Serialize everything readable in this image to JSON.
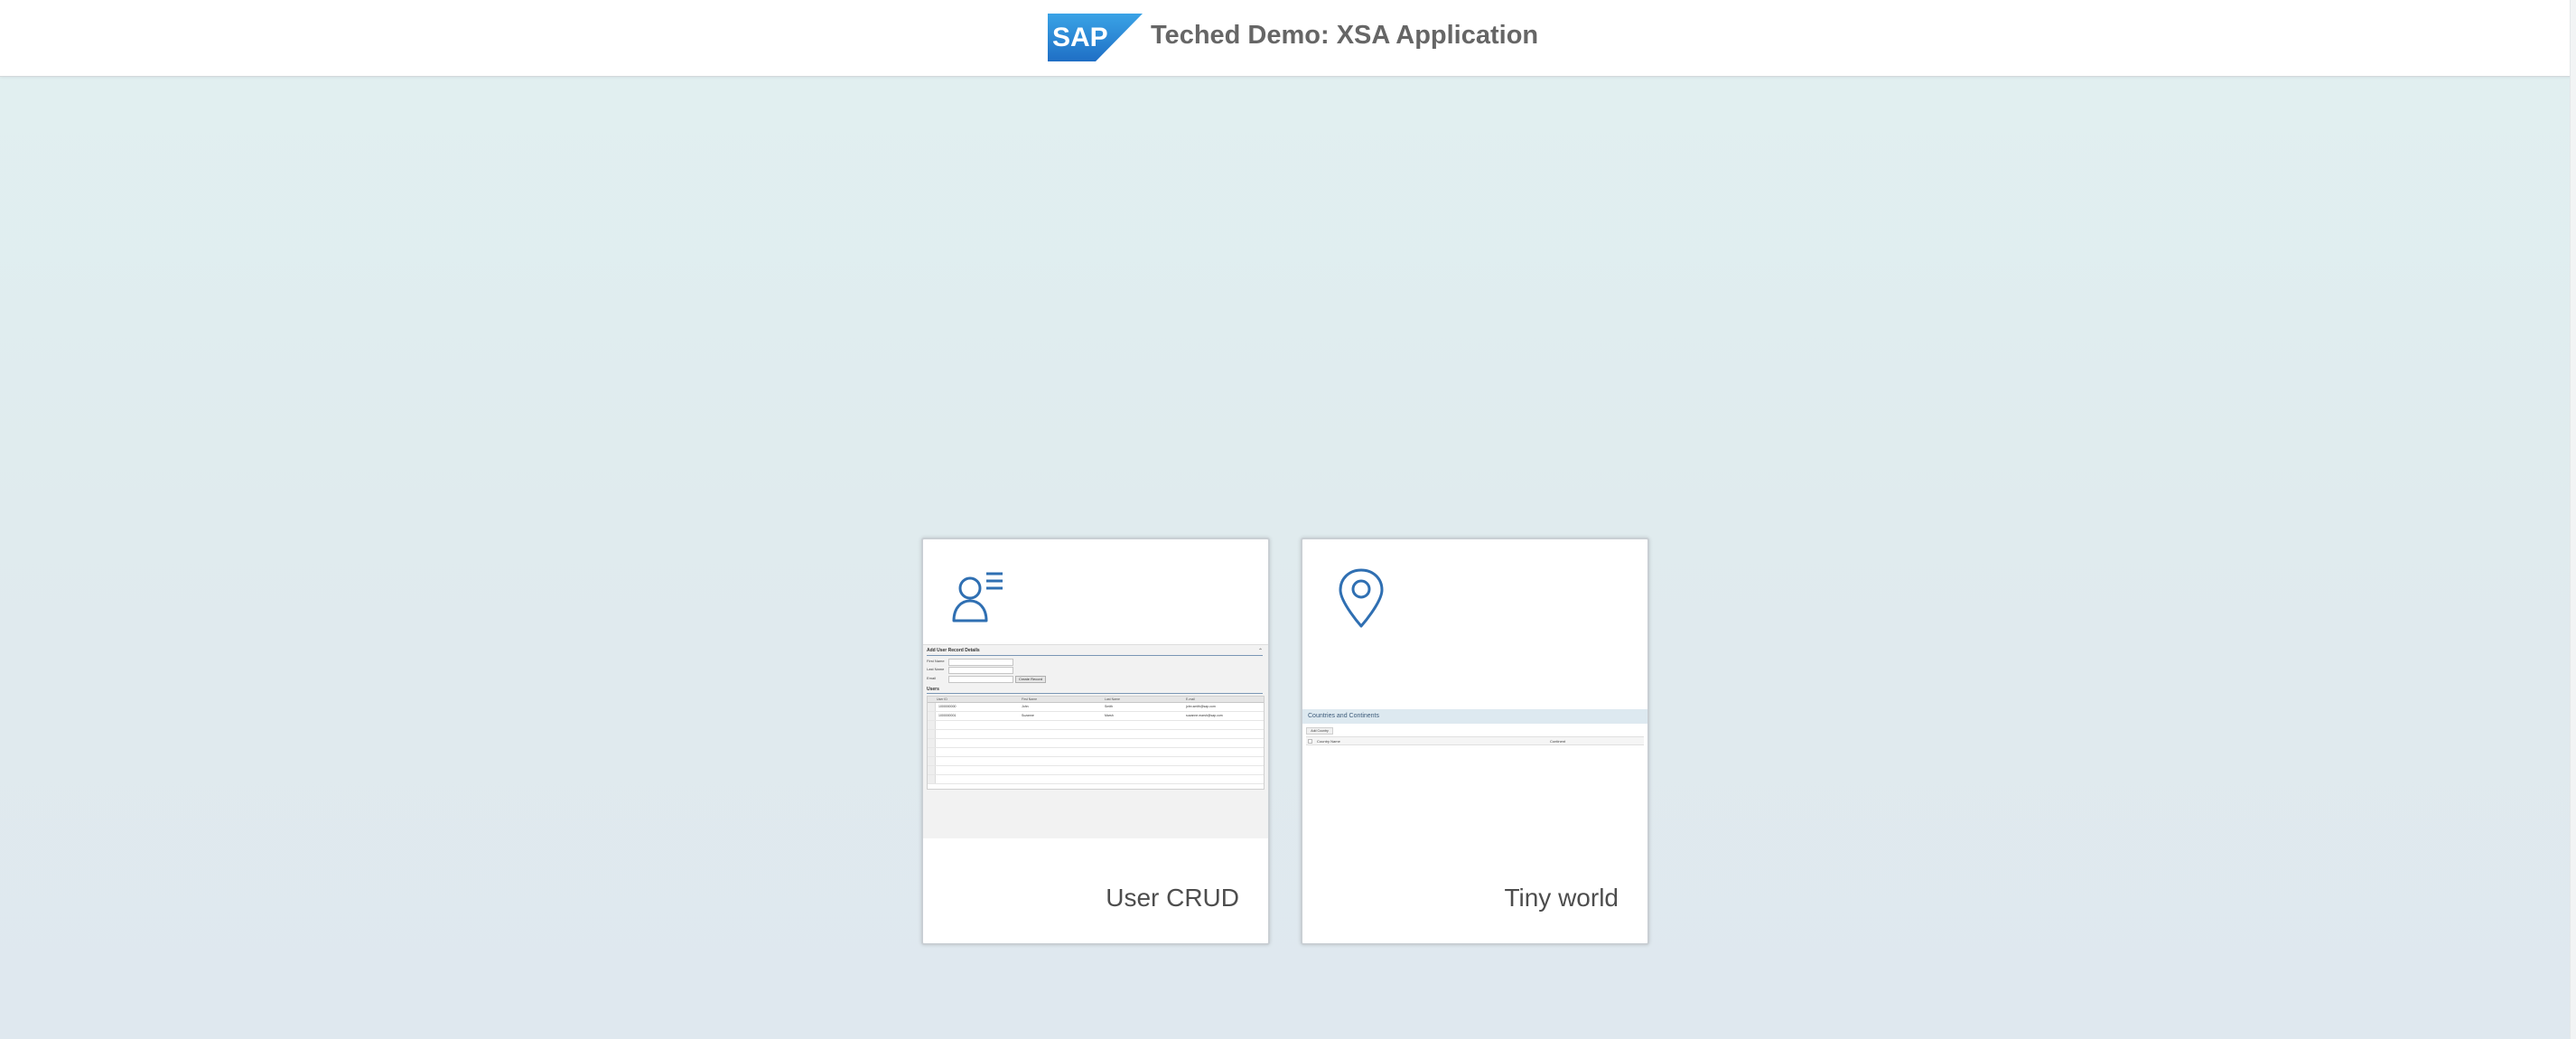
{
  "header": {
    "logo_text": "SAP",
    "title": "Teched Demo: XSA Application"
  },
  "colors": {
    "accent": "#2f6fb2",
    "logo_blue": "#1f6fc5",
    "background_top": "#e1f0f1",
    "background_bottom": "#dfe8ef"
  },
  "tiles": [
    {
      "label": "User CRUD",
      "icon": "user-list-icon",
      "preview": {
        "panel_title": "Add User Record Details",
        "fields": [
          "First Name",
          "Last Name",
          "Email"
        ],
        "button": "Create Record",
        "section_title": "Users",
        "columns": [
          "User ID",
          "First Name",
          "Last Name",
          "E-mail"
        ],
        "rows": [
          [
            "1000000000",
            "John",
            "Smith",
            "john.smith@sap.com"
          ],
          [
            "1000000001",
            "Suzanne",
            "Marsh",
            "suzanne.marsh@sap.com"
          ]
        ]
      }
    },
    {
      "label": "Tiny world",
      "icon": "map-pin-icon",
      "preview": {
        "panel_title": "Countries and Continents",
        "button": "Add Country",
        "columns": [
          "Country Name",
          "Continent"
        ]
      }
    }
  ]
}
